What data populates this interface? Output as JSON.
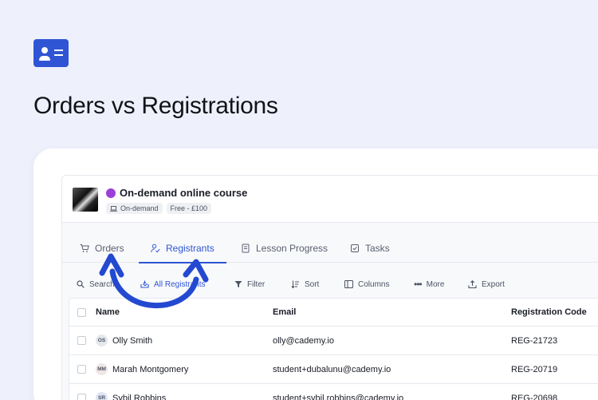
{
  "page": {
    "title": "Orders vs Registrations"
  },
  "course": {
    "title": "On-demand online course",
    "tags": [
      "On-demand",
      "Free - £100"
    ]
  },
  "tabs": [
    {
      "label": "Orders",
      "icon": "cart-icon"
    },
    {
      "label": "Registrants",
      "icon": "user-check-icon",
      "active": true
    },
    {
      "label": "Lesson Progress",
      "icon": "book-icon"
    },
    {
      "label": "Tasks",
      "icon": "checkbox-icon"
    }
  ],
  "toolbar": {
    "search": "Search",
    "view": "All Registrants",
    "filter": "Filter",
    "sort": "Sort",
    "columns": "Columns",
    "more": "More",
    "export": "Export"
  },
  "table": {
    "headers": {
      "name": "Name",
      "email": "Email",
      "code": "Registration Code"
    },
    "rows": [
      {
        "initials": "OS",
        "name": "Olly Smith",
        "email": "olly@cademy.io",
        "code": "REG-21723"
      },
      {
        "initials": "MM",
        "name": "Marah Montgomery",
        "email": "student+dubalunu@cademy.io",
        "code": "REG-20719"
      },
      {
        "initials": "SR",
        "name": "Sybil Robbins",
        "email": "student+sybil.robbins@cademy.io",
        "code": "REG-20698"
      }
    ]
  },
  "colors": {
    "accent": "#2f55d4",
    "background": "#eef1fb",
    "course_dot": "#9b3fd8"
  }
}
